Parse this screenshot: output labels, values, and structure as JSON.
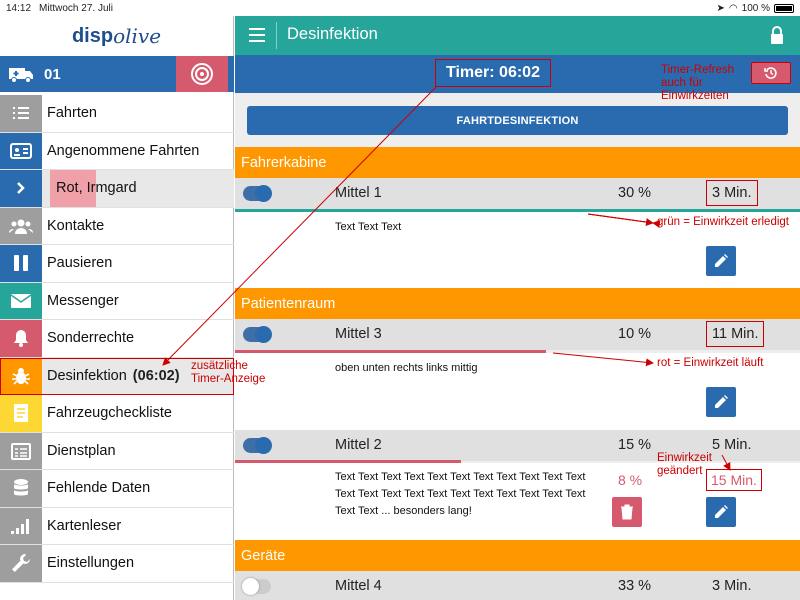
{
  "status": {
    "time": "14:12",
    "date": "Mittwoch 27. Juli",
    "battery": "100 %"
  },
  "logo": {
    "part1": "disp",
    "part2": "olive"
  },
  "vehicle": {
    "number": "01"
  },
  "menu": [
    {
      "label": "Fahrten",
      "icon": "list-icon",
      "color": "#9e9e9e"
    },
    {
      "label": "Angenommene Fahrten",
      "icon": "id-card-icon",
      "color": "#2a6bb0"
    },
    {
      "label": "Rot, Irmgard",
      "icon": "chevron-right-icon",
      "color": "#2a6bb0"
    },
    {
      "label": "Kontakte",
      "icon": "people-icon",
      "color": "#9e9e9e"
    },
    {
      "label": "Pausieren",
      "icon": "pause-icon",
      "color": "#2a6bb0"
    },
    {
      "label": "Messenger",
      "icon": "mail-icon",
      "color": "#26a69a"
    },
    {
      "label": "Sonderrechte",
      "icon": "bell-icon",
      "color": "#d65a6e"
    },
    {
      "label": "Desinfektion",
      "timer": "(06:02)",
      "icon": "bug-icon",
      "color": "#ff9800"
    },
    {
      "label": "Fahrzeugcheckliste",
      "icon": "checklist-icon",
      "color": "#fdd835"
    },
    {
      "label": "Dienstplan",
      "icon": "schedule-icon",
      "color": "#9e9e9e"
    },
    {
      "label": "Fehlende Daten",
      "icon": "database-icon",
      "color": "#9e9e9e"
    },
    {
      "label": "Kartenleser",
      "icon": "signal-icon",
      "color": "#9e9e9e"
    },
    {
      "label": "Einstellungen",
      "icon": "wrench-icon",
      "color": "#9e9e9e"
    }
  ],
  "header": {
    "title": "Desinfektion"
  },
  "timer": {
    "label": "Timer: 06:02"
  },
  "main": {
    "button": "FAHRTDESINFEKTION",
    "sections": [
      {
        "title": "Fahrerkabine"
      },
      {
        "title": "Patientenraum"
      },
      {
        "title": "Geräte"
      }
    ],
    "rows": [
      {
        "name": "Mittel 1",
        "pct": "30 %",
        "min": "3 Min.",
        "text": "Text Text Text",
        "on": true,
        "status_color": "#26a69a",
        "progress": 1.0
      },
      {
        "name": "Mittel 3",
        "pct": "10 %",
        "min": "11 Min.",
        "text": "oben unten rechts links mittig",
        "on": true,
        "status_color": "#d65a6e",
        "progress": 0.55
      },
      {
        "name": "Mittel 2",
        "pct": "15 %",
        "min": "5 Min.",
        "text1": "Text Text Text Text Text Text Text Text Text Text Text",
        "text2": "Text Text Text Text Text Text Text Text Text Text Text",
        "text3": "Text Text ... besonders lang!",
        "edit_pct": "8 %",
        "edit_min": "15 Min.",
        "on": true,
        "status_color": "#d65a6e",
        "progress": 0.4
      },
      {
        "name": "Mittel 4",
        "pct": "33 %",
        "min": "3 Min.",
        "on": false
      }
    ]
  },
  "notes": {
    "timer_refresh": [
      "Timer-Refresh",
      "auch für",
      "Einwirkzeiten"
    ],
    "sidebar_timer": [
      "zusätzliche",
      "Timer-Anzeige"
    ],
    "green": "grün = Einwirkzeit erledigt",
    "red": "rot = Einwirkzeit läuft",
    "changed": [
      "Einwirkzeit",
      "geändert"
    ]
  },
  "colors": {
    "teal": "#26a69a",
    "blue": "#2a6bb0",
    "orange": "#ff9800",
    "red": "#d65a6e",
    "annotation": "#cc0000"
  }
}
